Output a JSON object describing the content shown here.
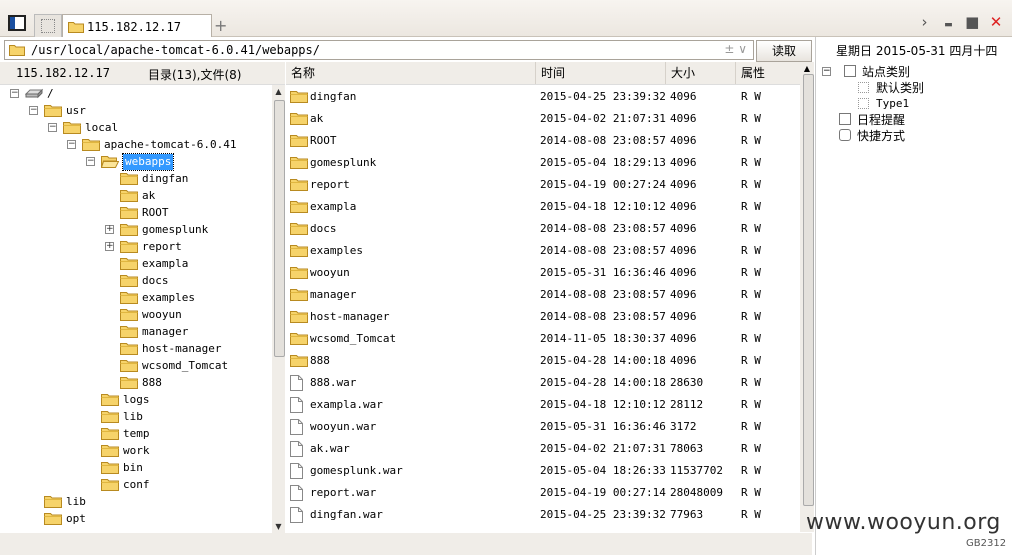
{
  "tab": {
    "label": "115.182.12.17",
    "add": "+"
  },
  "window_controls": {
    "next": "›",
    "minimize": "▬",
    "maximize": "■",
    "close": "✕"
  },
  "path": {
    "value": "/usr/local/apache-tomcat-6.0.41/webapps/",
    "actions": "± ∨",
    "read_button": "读取"
  },
  "tree_header": {
    "host": "115.182.12.17",
    "counts": "目录(13),文件(8)"
  },
  "columns": {
    "name": "名称",
    "time": "时间",
    "size": "大小",
    "attr": "属性"
  },
  "tree": [
    {
      "label": "/",
      "level": 0,
      "exp": "−",
      "icon": "drive"
    },
    {
      "label": "usr",
      "level": 1,
      "exp": "−",
      "icon": "folder"
    },
    {
      "label": "local",
      "level": 2,
      "exp": "−",
      "icon": "folder"
    },
    {
      "label": "apache-tomcat-6.0.41",
      "level": 3,
      "exp": "−",
      "icon": "folder"
    },
    {
      "label": "webapps",
      "level": 4,
      "exp": "−",
      "icon": "folder-open",
      "selected": true
    },
    {
      "label": "dingfan",
      "level": 5,
      "exp": "",
      "icon": "folder"
    },
    {
      "label": "ak",
      "level": 5,
      "exp": "",
      "icon": "folder"
    },
    {
      "label": "ROOT",
      "level": 5,
      "exp": "",
      "icon": "folder"
    },
    {
      "label": "gomesplunk",
      "level": 5,
      "exp": "+",
      "icon": "folder"
    },
    {
      "label": "report",
      "level": 5,
      "exp": "+",
      "icon": "folder"
    },
    {
      "label": "exampla",
      "level": 5,
      "exp": "",
      "icon": "folder"
    },
    {
      "label": "docs",
      "level": 5,
      "exp": "",
      "icon": "folder"
    },
    {
      "label": "examples",
      "level": 5,
      "exp": "",
      "icon": "folder"
    },
    {
      "label": "wooyun",
      "level": 5,
      "exp": "",
      "icon": "folder"
    },
    {
      "label": "manager",
      "level": 5,
      "exp": "",
      "icon": "folder"
    },
    {
      "label": "host-manager",
      "level": 5,
      "exp": "",
      "icon": "folder"
    },
    {
      "label": "wcsomd_Tomcat",
      "level": 5,
      "exp": "",
      "icon": "folder"
    },
    {
      "label": "888",
      "level": 5,
      "exp": "",
      "icon": "folder"
    },
    {
      "label": "logs",
      "level": 4,
      "exp": "",
      "icon": "folder"
    },
    {
      "label": "lib",
      "level": 4,
      "exp": "",
      "icon": "folder"
    },
    {
      "label": "temp",
      "level": 4,
      "exp": "",
      "icon": "folder"
    },
    {
      "label": "work",
      "level": 4,
      "exp": "",
      "icon": "folder"
    },
    {
      "label": "bin",
      "level": 4,
      "exp": "",
      "icon": "folder"
    },
    {
      "label": "conf",
      "level": 4,
      "exp": "",
      "icon": "folder"
    },
    {
      "label": "lib",
      "level": 1,
      "exp": "",
      "icon": "folder"
    },
    {
      "label": "opt",
      "level": 1,
      "exp": "",
      "icon": "folder"
    }
  ],
  "files": [
    {
      "name": "dingfan",
      "time": "2015-04-25 23:39:32",
      "size": "4096",
      "attr": "R W",
      "type": "dir"
    },
    {
      "name": "ak",
      "time": "2015-04-02 21:07:31",
      "size": "4096",
      "attr": "R W",
      "type": "dir"
    },
    {
      "name": "ROOT",
      "time": "2014-08-08 23:08:57",
      "size": "4096",
      "attr": "R W",
      "type": "dir"
    },
    {
      "name": "gomesplunk",
      "time": "2015-05-04 18:29:13",
      "size": "4096",
      "attr": "R W",
      "type": "dir"
    },
    {
      "name": "report",
      "time": "2015-04-19 00:27:24",
      "size": "4096",
      "attr": "R W",
      "type": "dir"
    },
    {
      "name": "exampla",
      "time": "2015-04-18 12:10:12",
      "size": "4096",
      "attr": "R W",
      "type": "dir"
    },
    {
      "name": "docs",
      "time": "2014-08-08 23:08:57",
      "size": "4096",
      "attr": "R W",
      "type": "dir"
    },
    {
      "name": "examples",
      "time": "2014-08-08 23:08:57",
      "size": "4096",
      "attr": "R W",
      "type": "dir"
    },
    {
      "name": "wooyun",
      "time": "2015-05-31 16:36:46",
      "size": "4096",
      "attr": "R W",
      "type": "dir"
    },
    {
      "name": "manager",
      "time": "2014-08-08 23:08:57",
      "size": "4096",
      "attr": "R W",
      "type": "dir"
    },
    {
      "name": "host-manager",
      "time": "2014-08-08 23:08:57",
      "size": "4096",
      "attr": "R W",
      "type": "dir"
    },
    {
      "name": "wcsomd_Tomcat",
      "time": "2014-11-05 18:30:37",
      "size": "4096",
      "attr": "R W",
      "type": "dir"
    },
    {
      "name": "888",
      "time": "2015-04-28 14:00:18",
      "size": "4096",
      "attr": "R W",
      "type": "dir"
    },
    {
      "name": "888.war",
      "time": "2015-04-28 14:00:18",
      "size": "28630",
      "attr": "R W",
      "type": "file"
    },
    {
      "name": "exampla.war",
      "time": "2015-04-18 12:10:12",
      "size": "28112",
      "attr": "R W",
      "type": "file"
    },
    {
      "name": "wooyun.war",
      "time": "2015-05-31 16:36:46",
      "size": "3172",
      "attr": "R W",
      "type": "file"
    },
    {
      "name": "ak.war",
      "time": "2015-04-02 21:07:31",
      "size": "78063",
      "attr": "R W",
      "type": "file"
    },
    {
      "name": "gomesplunk.war",
      "time": "2015-05-04 18:26:33",
      "size": "11537702",
      "attr": "R W",
      "type": "file"
    },
    {
      "name": "report.war",
      "time": "2015-04-19 00:27:14",
      "size": "28048009",
      "attr": "R W",
      "type": "file"
    },
    {
      "name": "dingfan.war",
      "time": "2015-04-25 23:39:32",
      "size": "77963",
      "attr": "R W",
      "type": "file"
    }
  ],
  "right_panel": {
    "date": "星期日 2015-05-31 四月十四",
    "site_category": "站点类别",
    "default_category": "默认类别",
    "type1": "Type1",
    "schedule": "日程提醒",
    "shortcuts": "快捷方式"
  },
  "watermark": "www.wooyun.org",
  "encoding": "GB2312"
}
